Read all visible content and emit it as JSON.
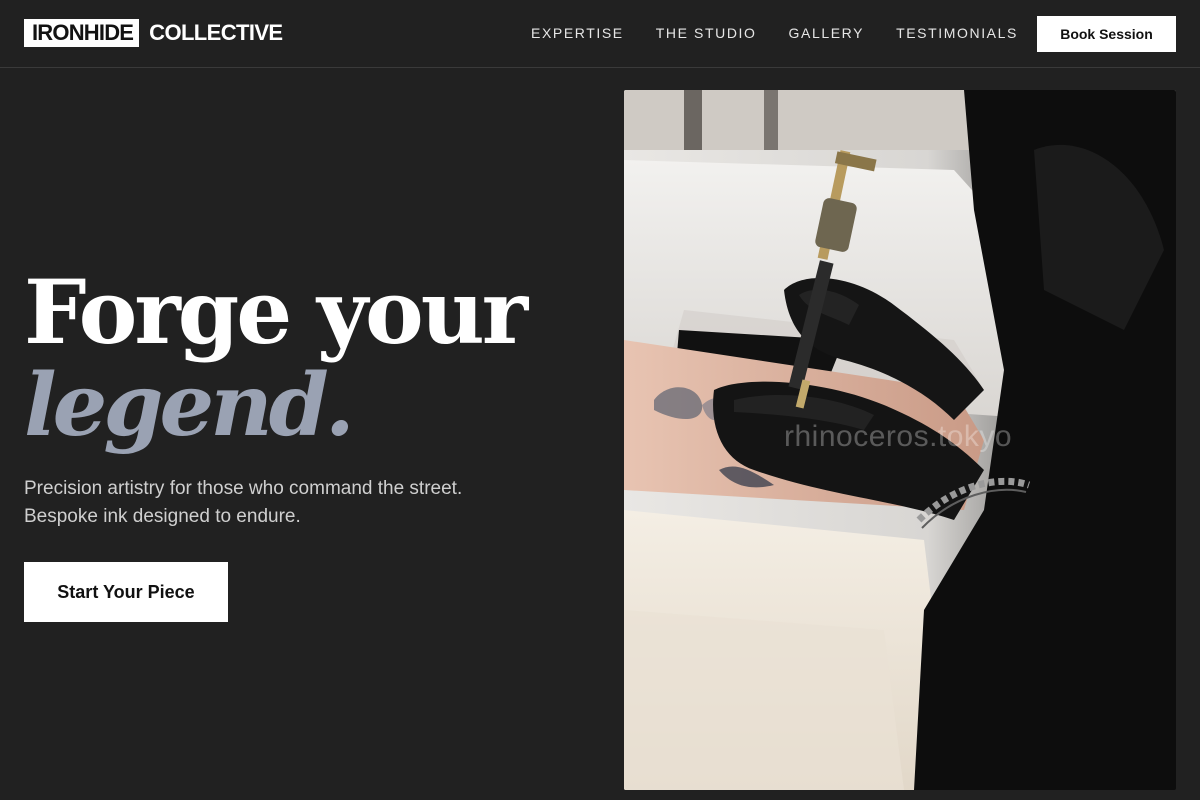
{
  "brand": {
    "name_box": "IRONHIDE",
    "name_rest": "COLLECTIVE"
  },
  "nav": {
    "items": [
      {
        "label": "EXPERTISE"
      },
      {
        "label": "THE STUDIO"
      },
      {
        "label": "GALLERY"
      },
      {
        "label": "TESTIMONIALS"
      }
    ],
    "cta_label": "Book Session"
  },
  "hero": {
    "title_line1": "Forge your",
    "title_line2": "legend.",
    "subtitle": "Precision artistry for those who command the street. Bespoke ink designed to endure.",
    "cta_label": "Start Your Piece",
    "image": {
      "subject": "tattoo-artist-at-work-photo",
      "watermark": "rhinoceros.tokyo"
    }
  },
  "colors": {
    "background": "#212121",
    "accent_text": "#9aa2b3",
    "button_bg": "#ffffff",
    "button_text": "#111111"
  }
}
